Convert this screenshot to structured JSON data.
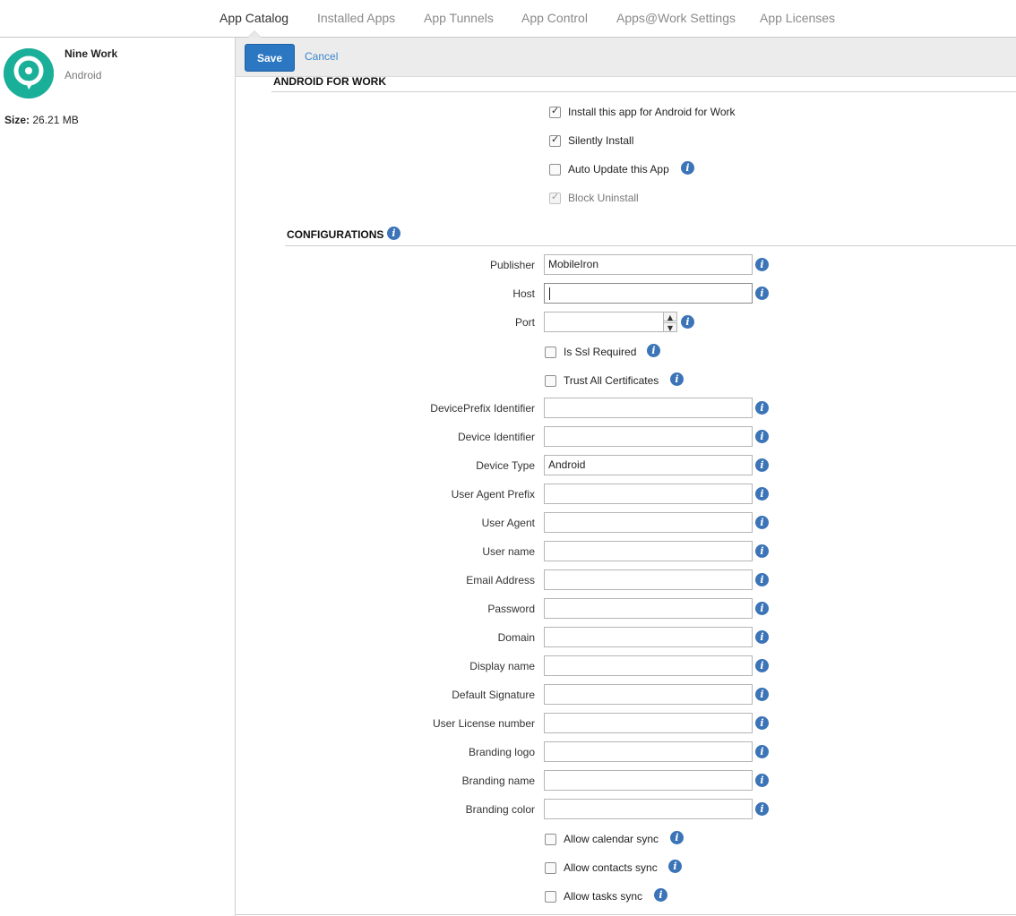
{
  "nav": {
    "tabs": [
      {
        "label": "App Catalog"
      },
      {
        "label": "Installed Apps"
      },
      {
        "label": "App Tunnels"
      },
      {
        "label": "App Control"
      },
      {
        "label": "Apps@Work Settings"
      },
      {
        "label": "App Licenses"
      }
    ],
    "active_tab": "App Catalog"
  },
  "app": {
    "name": "Nine Work",
    "platform": "Android",
    "size_label": "Size:",
    "size_value": "26.21 MB",
    "logo_color": "#1aaf99"
  },
  "toolbar": {
    "save_label": "Save",
    "cancel_label": "Cancel"
  },
  "android_for_work": {
    "title": "ANDROID FOR WORK",
    "options": [
      {
        "label": "Install this app for Android for Work",
        "checked": true,
        "disabled": false,
        "info": false
      },
      {
        "label": "Silently Install",
        "checked": true,
        "disabled": false,
        "info": false
      },
      {
        "label": "Auto Update this App",
        "checked": false,
        "disabled": false,
        "info": true
      },
      {
        "label": "Block Uninstall",
        "checked": true,
        "disabled": true,
        "info": false
      }
    ]
  },
  "configurations": {
    "title": "CONFIGURATIONS",
    "fields": {
      "publisher": {
        "label": "Publisher",
        "value": "MobileIron"
      },
      "host": {
        "label": "Host",
        "value": ""
      },
      "port": {
        "label": "Port",
        "value": ""
      },
      "is_ssl_required": {
        "label": "Is Ssl Required",
        "checked": false
      },
      "trust_all_certificates": {
        "label": "Trust All Certificates",
        "checked": false
      },
      "device_prefix_identifier": {
        "label": "DevicePrefix Identifier",
        "value": ""
      },
      "device_identifier": {
        "label": "Device Identifier",
        "value": ""
      },
      "device_type": {
        "label": "Device Type",
        "value": "Android"
      },
      "user_agent_prefix": {
        "label": "User Agent Prefix",
        "value": ""
      },
      "user_agent": {
        "label": "User Agent",
        "value": ""
      },
      "user_name": {
        "label": "User name",
        "value": ""
      },
      "email_address": {
        "label": "Email Address",
        "value": ""
      },
      "password": {
        "label": "Password",
        "value": ""
      },
      "domain": {
        "label": "Domain",
        "value": ""
      },
      "display_name": {
        "label": "Display name",
        "value": ""
      },
      "default_signature": {
        "label": "Default Signature",
        "value": ""
      },
      "user_license_number": {
        "label": "User License number",
        "value": ""
      },
      "branding_logo": {
        "label": "Branding logo",
        "value": ""
      },
      "branding_name": {
        "label": "Branding name",
        "value": ""
      },
      "branding_color": {
        "label": "Branding color",
        "value": ""
      },
      "allow_calendar_sync": {
        "label": "Allow calendar sync",
        "checked": false
      },
      "allow_contacts_sync": {
        "label": "Allow contacts sync",
        "checked": false
      },
      "allow_tasks_sync": {
        "label": "Allow tasks sync",
        "checked": false
      }
    }
  },
  "icons": {
    "info": "info-icon",
    "spinner_up": "chevron-up-icon",
    "spinner_down": "chevron-down-icon"
  },
  "colors": {
    "accent": "#2b77c2",
    "link": "#3b86cc",
    "info_icon": "#3c74b8"
  }
}
